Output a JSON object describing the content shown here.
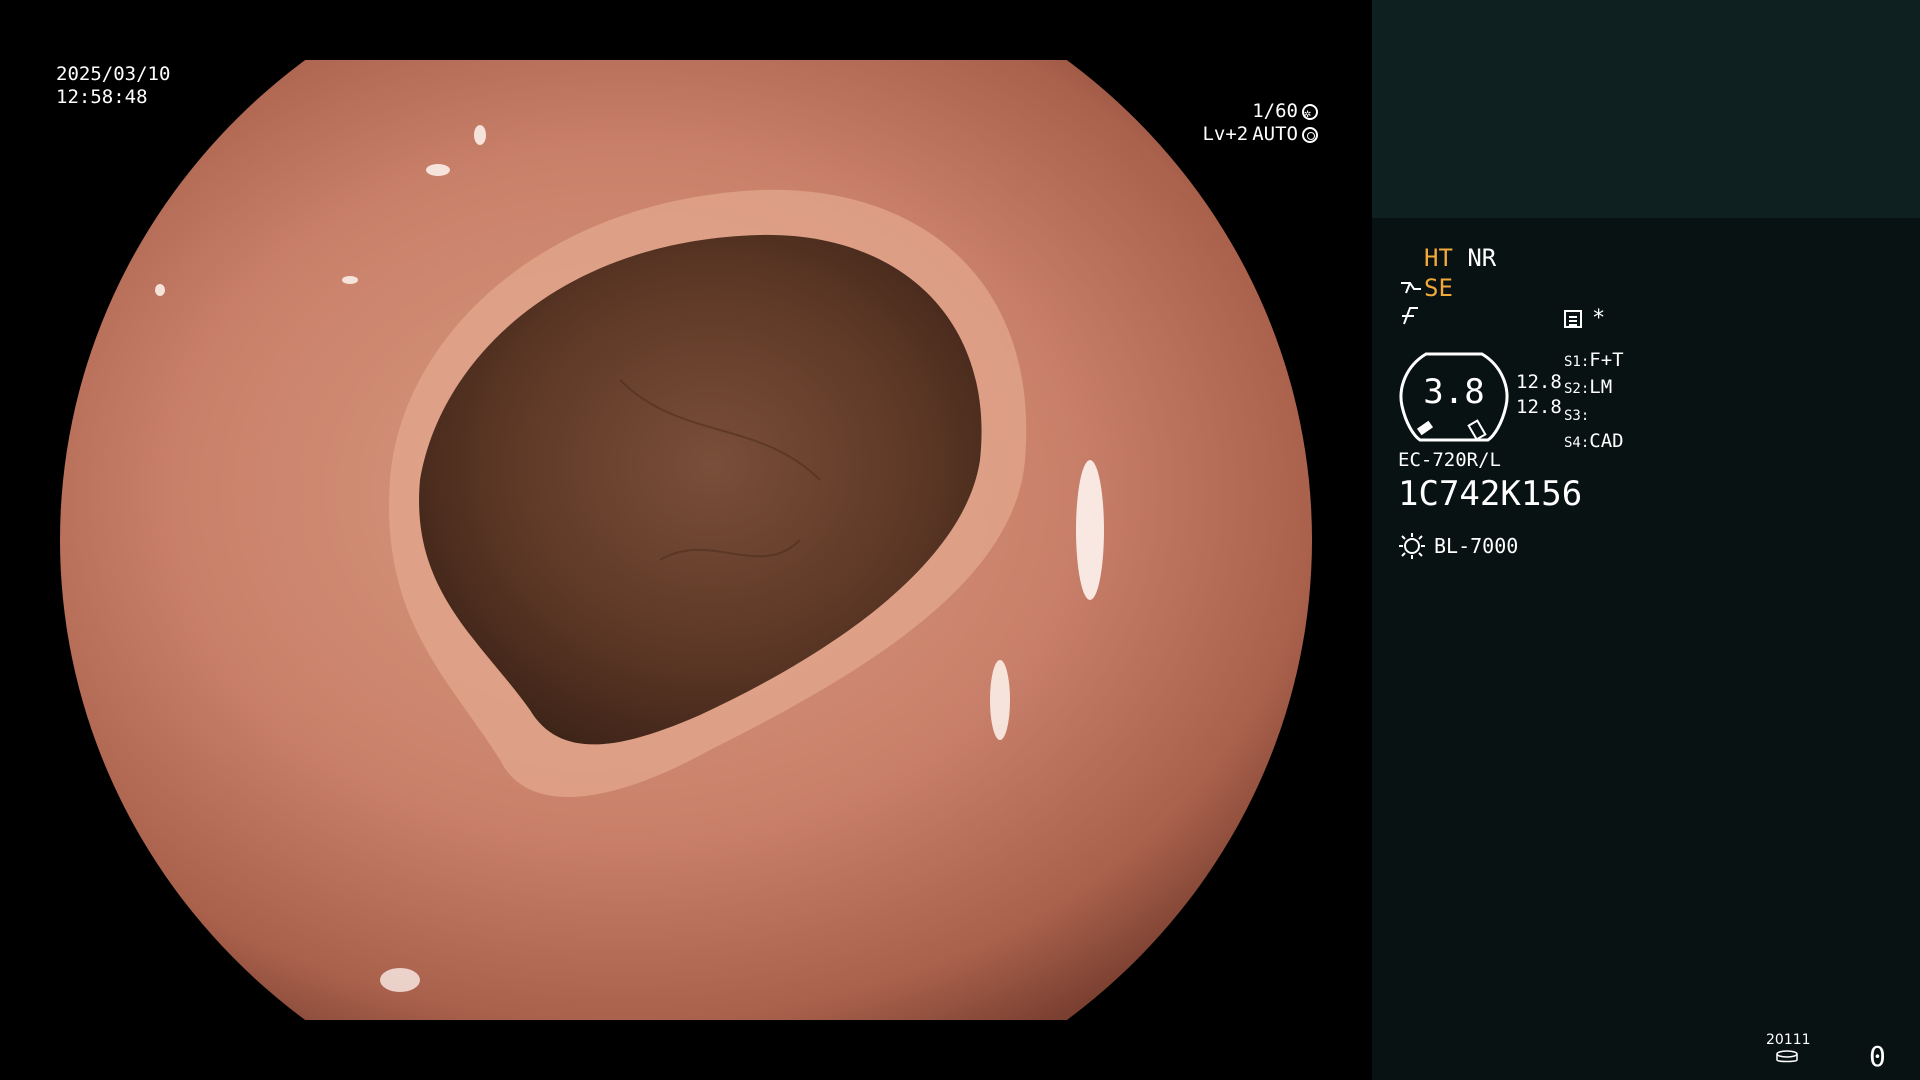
{
  "overlay": {
    "date": "2025/03/10",
    "time": "12:58:48",
    "shutter": "1/60",
    "level": "Lv+2",
    "iris_mode": "AUTO"
  },
  "icons": {
    "shutter": "shutter-icon",
    "iris": "iris-icon",
    "scope_tip": "scope-tip-icon",
    "freeze": "freeze-icon",
    "memo": "memo-icon",
    "light_source": "light-source-icon",
    "storage": "storage-icon"
  },
  "panel": {
    "mode_ht": "HT",
    "mode_nr": "NR",
    "mode_se": "SE",
    "asterisk": "*",
    "gauge_value": "3.8",
    "gauge_readout_1": "12.8",
    "gauge_readout_2": "12.8",
    "s_items": [
      {
        "key": "S1:",
        "value": "F+T"
      },
      {
        "key": "S2:",
        "value": "LM"
      },
      {
        "key": "S3:",
        "value": ""
      },
      {
        "key": "S4:",
        "value": "CAD"
      }
    ],
    "scope_model": "EC-720R/L",
    "scope_serial": "1C742K156",
    "light_source": "BL-7000",
    "record_id": "20111",
    "counter": "0"
  },
  "colors": {
    "accent_orange": "#f2a93a",
    "panel_bg": "#081212",
    "panel_top_bg": "#0e2020",
    "mucosa": "#c9806a",
    "lumen": "#5a3525"
  }
}
